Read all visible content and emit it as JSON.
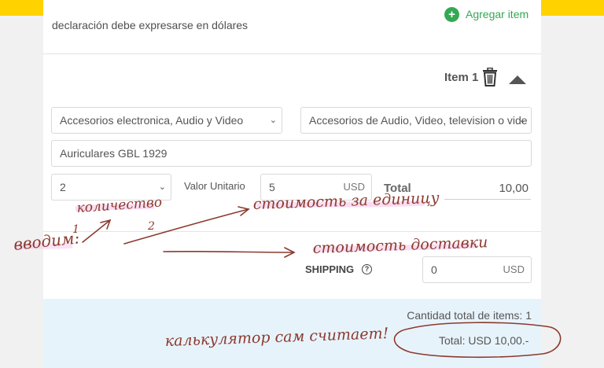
{
  "form": {
    "intro_text": "declaración debe expresarse en dólares",
    "add_item_label": "Agregar item",
    "item_title": "Item 1",
    "category": "Accesorios electronica, Audio y Video",
    "subcategory": "Accesorios de Audio, Video, television o vide",
    "product": "Auriculares GBL 1929",
    "quantity": "2",
    "unit_value_label": "Valor Unitario",
    "unit_value": "5",
    "currency": "USD",
    "total_label": "Total",
    "total_value": "10,00",
    "shipping_label": "SHIPPING",
    "help_glyph": "?",
    "shipping_value": "0",
    "shipping_currency": "USD"
  },
  "summary": {
    "items_count_text": "Cantidad total de items: 1",
    "total_text": "Total: USD 10,00.-"
  },
  "annotations": {
    "enter": "вводим:",
    "num1": "1",
    "num2": "2",
    "quantity_note": "количество",
    "unit_cost_note": "стоимость за единицу",
    "shipping_note": "стоимость доставки",
    "calc_note": "калькулятор сам считает!"
  },
  "colors": {
    "header_yellow": "#ffd200",
    "add_green": "#34a853",
    "summary_bg": "#e7f3fb",
    "ink": "#8b3a2e",
    "highlight": "#f7c6ea"
  },
  "icons": {
    "add": "plus-circle-icon",
    "delete": "trash-icon",
    "collapse": "caret-up-icon",
    "dropdown": "chevron-down-icon",
    "help": "question-circle-icon"
  }
}
